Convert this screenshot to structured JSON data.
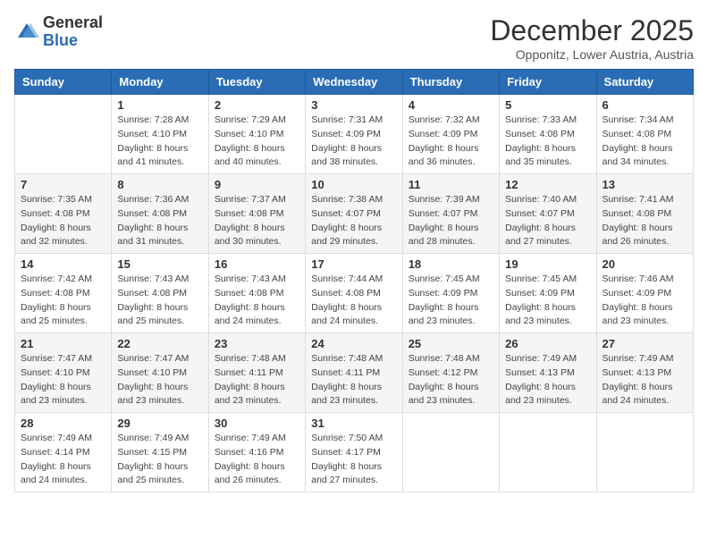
{
  "header": {
    "logo_general": "General",
    "logo_blue": "Blue",
    "month_title": "December 2025",
    "location": "Opponitz, Lower Austria, Austria"
  },
  "days_of_week": [
    "Sunday",
    "Monday",
    "Tuesday",
    "Wednesday",
    "Thursday",
    "Friday",
    "Saturday"
  ],
  "weeks": [
    [
      {
        "num": "",
        "info": ""
      },
      {
        "num": "1",
        "info": "Sunrise: 7:28 AM\nSunset: 4:10 PM\nDaylight: 8 hours\nand 41 minutes."
      },
      {
        "num": "2",
        "info": "Sunrise: 7:29 AM\nSunset: 4:10 PM\nDaylight: 8 hours\nand 40 minutes."
      },
      {
        "num": "3",
        "info": "Sunrise: 7:31 AM\nSunset: 4:09 PM\nDaylight: 8 hours\nand 38 minutes."
      },
      {
        "num": "4",
        "info": "Sunrise: 7:32 AM\nSunset: 4:09 PM\nDaylight: 8 hours\nand 36 minutes."
      },
      {
        "num": "5",
        "info": "Sunrise: 7:33 AM\nSunset: 4:08 PM\nDaylight: 8 hours\nand 35 minutes."
      },
      {
        "num": "6",
        "info": "Sunrise: 7:34 AM\nSunset: 4:08 PM\nDaylight: 8 hours\nand 34 minutes."
      }
    ],
    [
      {
        "num": "7",
        "info": "Sunrise: 7:35 AM\nSunset: 4:08 PM\nDaylight: 8 hours\nand 32 minutes."
      },
      {
        "num": "8",
        "info": "Sunrise: 7:36 AM\nSunset: 4:08 PM\nDaylight: 8 hours\nand 31 minutes."
      },
      {
        "num": "9",
        "info": "Sunrise: 7:37 AM\nSunset: 4:08 PM\nDaylight: 8 hours\nand 30 minutes."
      },
      {
        "num": "10",
        "info": "Sunrise: 7:38 AM\nSunset: 4:07 PM\nDaylight: 8 hours\nand 29 minutes."
      },
      {
        "num": "11",
        "info": "Sunrise: 7:39 AM\nSunset: 4:07 PM\nDaylight: 8 hours\nand 28 minutes."
      },
      {
        "num": "12",
        "info": "Sunrise: 7:40 AM\nSunset: 4:07 PM\nDaylight: 8 hours\nand 27 minutes."
      },
      {
        "num": "13",
        "info": "Sunrise: 7:41 AM\nSunset: 4:08 PM\nDaylight: 8 hours\nand 26 minutes."
      }
    ],
    [
      {
        "num": "14",
        "info": "Sunrise: 7:42 AM\nSunset: 4:08 PM\nDaylight: 8 hours\nand 25 minutes."
      },
      {
        "num": "15",
        "info": "Sunrise: 7:43 AM\nSunset: 4:08 PM\nDaylight: 8 hours\nand 25 minutes."
      },
      {
        "num": "16",
        "info": "Sunrise: 7:43 AM\nSunset: 4:08 PM\nDaylight: 8 hours\nand 24 minutes."
      },
      {
        "num": "17",
        "info": "Sunrise: 7:44 AM\nSunset: 4:08 PM\nDaylight: 8 hours\nand 24 minutes."
      },
      {
        "num": "18",
        "info": "Sunrise: 7:45 AM\nSunset: 4:09 PM\nDaylight: 8 hours\nand 23 minutes."
      },
      {
        "num": "19",
        "info": "Sunrise: 7:45 AM\nSunset: 4:09 PM\nDaylight: 8 hours\nand 23 minutes."
      },
      {
        "num": "20",
        "info": "Sunrise: 7:46 AM\nSunset: 4:09 PM\nDaylight: 8 hours\nand 23 minutes."
      }
    ],
    [
      {
        "num": "21",
        "info": "Sunrise: 7:47 AM\nSunset: 4:10 PM\nDaylight: 8 hours\nand 23 minutes."
      },
      {
        "num": "22",
        "info": "Sunrise: 7:47 AM\nSunset: 4:10 PM\nDaylight: 8 hours\nand 23 minutes."
      },
      {
        "num": "23",
        "info": "Sunrise: 7:48 AM\nSunset: 4:11 PM\nDaylight: 8 hours\nand 23 minutes."
      },
      {
        "num": "24",
        "info": "Sunrise: 7:48 AM\nSunset: 4:11 PM\nDaylight: 8 hours\nand 23 minutes."
      },
      {
        "num": "25",
        "info": "Sunrise: 7:48 AM\nSunset: 4:12 PM\nDaylight: 8 hours\nand 23 minutes."
      },
      {
        "num": "26",
        "info": "Sunrise: 7:49 AM\nSunset: 4:13 PM\nDaylight: 8 hours\nand 23 minutes."
      },
      {
        "num": "27",
        "info": "Sunrise: 7:49 AM\nSunset: 4:13 PM\nDaylight: 8 hours\nand 24 minutes."
      }
    ],
    [
      {
        "num": "28",
        "info": "Sunrise: 7:49 AM\nSunset: 4:14 PM\nDaylight: 8 hours\nand 24 minutes."
      },
      {
        "num": "29",
        "info": "Sunrise: 7:49 AM\nSunset: 4:15 PM\nDaylight: 8 hours\nand 25 minutes."
      },
      {
        "num": "30",
        "info": "Sunrise: 7:49 AM\nSunset: 4:16 PM\nDaylight: 8 hours\nand 26 minutes."
      },
      {
        "num": "31",
        "info": "Sunrise: 7:50 AM\nSunset: 4:17 PM\nDaylight: 8 hours\nand 27 minutes."
      },
      {
        "num": "",
        "info": ""
      },
      {
        "num": "",
        "info": ""
      },
      {
        "num": "",
        "info": ""
      }
    ]
  ]
}
